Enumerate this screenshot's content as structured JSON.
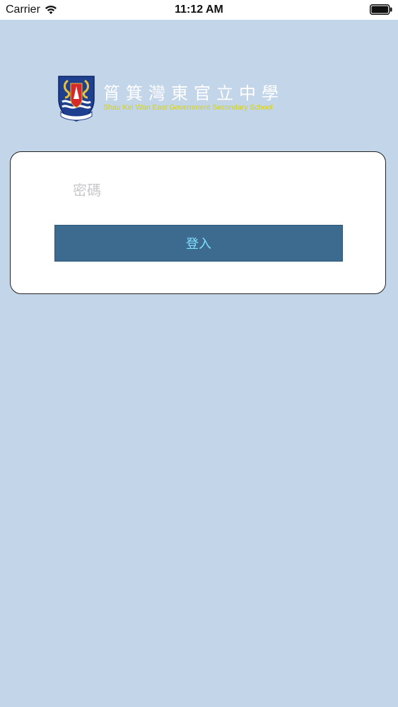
{
  "status_bar": {
    "carrier": "Carrier",
    "time": "11:12 AM",
    "wifi_icon": "wifi-icon",
    "battery_icon": "battery-icon"
  },
  "school": {
    "name_zh": "筲箕灣東官立中學",
    "name_en": "Shau Kei Wan East Government Secondary School",
    "crest_icon": "school-crest-icon"
  },
  "login": {
    "password_placeholder": "密碼",
    "password_value": "",
    "login_label": "登入"
  },
  "colors": {
    "background": "#c3d5e8",
    "button": "#3d6a8f",
    "button_text": "#7fe0ff",
    "school_name_en": "#d9d400"
  }
}
